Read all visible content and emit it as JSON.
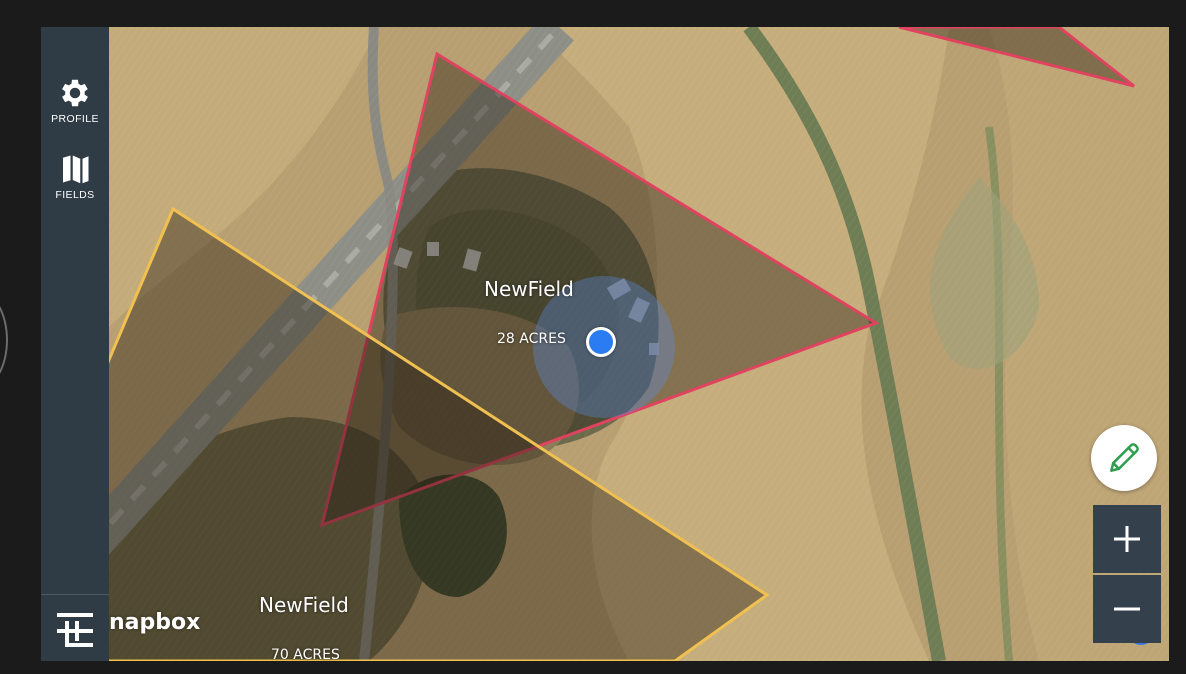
{
  "sidebar": {
    "profile_label": "PROFILE",
    "fields_label": "FIELDS",
    "profile_icon": "gear-icon",
    "fields_icon": "map-icon"
  },
  "map": {
    "fields": [
      {
        "name": "NewField",
        "acres": "28 ACRES",
        "outline_color": "#e0435f"
      },
      {
        "name": "NewField",
        "acres": "70 ACRES",
        "outline_color": "#f0c050"
      }
    ],
    "attribution": "napbox",
    "user_location_color": "#2b7bf2"
  },
  "controls": {
    "edit_icon": "pencil-icon",
    "zoom_in_icon": "plus-icon",
    "zoom_out_icon": "minus-icon",
    "accent": "#2e9e4f"
  }
}
